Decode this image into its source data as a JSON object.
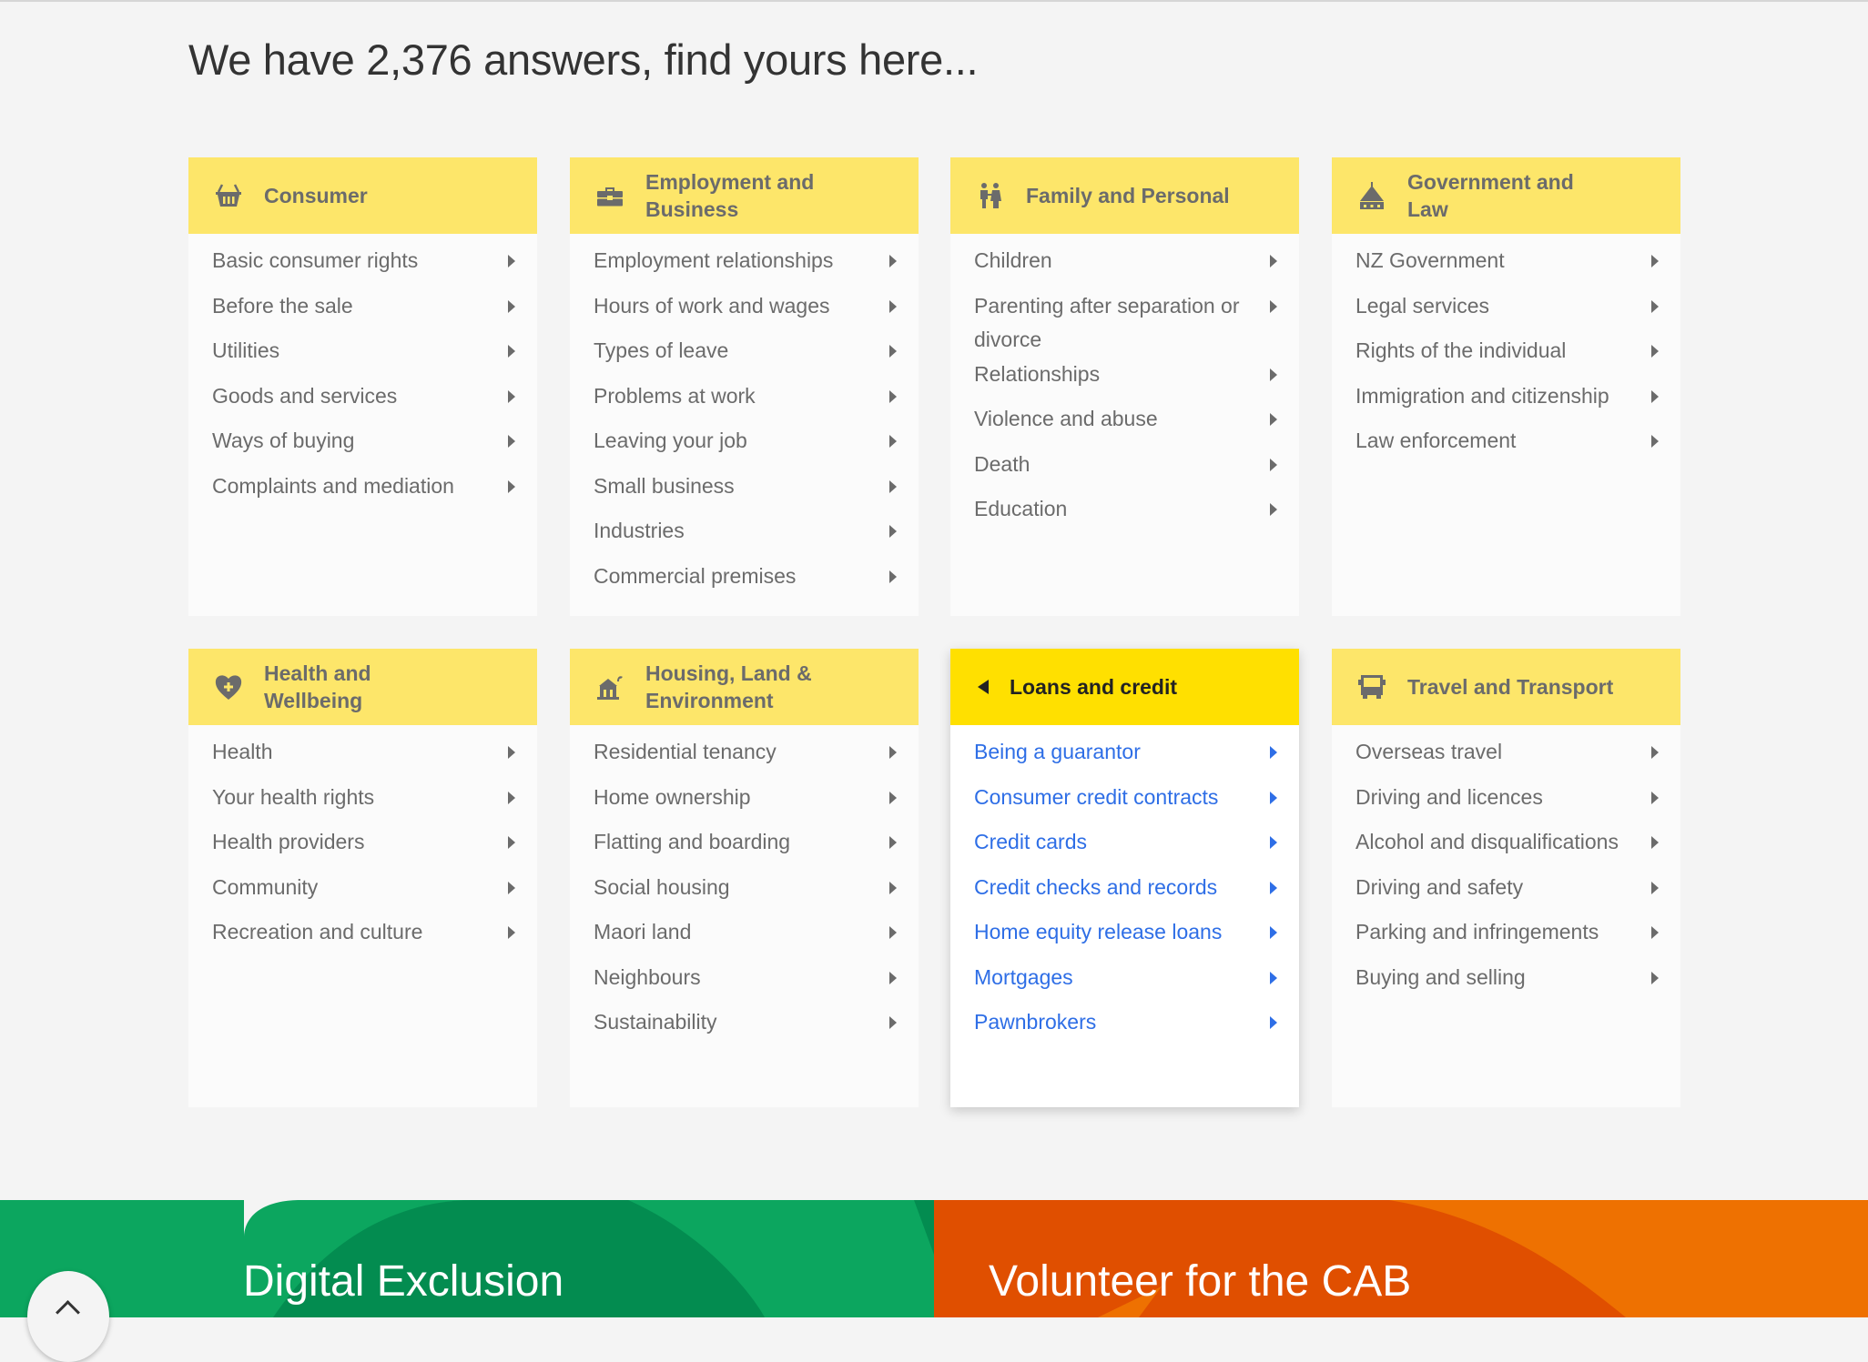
{
  "heading": "We have 2,376 answers, find yours here...",
  "colors": {
    "header_yellow": "#fde66a",
    "active_header_yellow": "#ffe000",
    "link_blue": "#2e6ee6",
    "text_grey": "#6b6b6b",
    "banner_green": "#0ca65f",
    "banner_orange": "#ee7101"
  },
  "cards": [
    {
      "title": "Consumer",
      "icon": "basket-icon",
      "items": [
        "Basic consumer rights",
        "Before the sale",
        "Utilities",
        "Goods and services",
        "Ways of buying",
        "Complaints and mediation"
      ]
    },
    {
      "title": "Employment and Business",
      "icon": "toolbox-icon",
      "items": [
        "Employment relationships",
        "Hours of work and wages",
        "Types of leave",
        "Problems at work",
        "Leaving your job",
        "Small business",
        "Industries",
        "Commercial premises"
      ]
    },
    {
      "title": "Family and Personal",
      "icon": "family-icon",
      "items": [
        "Children",
        "Parenting after separation or divorce",
        "Relationships",
        "Violence and abuse",
        "Death",
        "Education"
      ]
    },
    {
      "title": "Government and Law",
      "icon": "marae-icon",
      "items": [
        "NZ Government",
        "Legal services",
        "Rights of the individual",
        "Immigration and citizenship",
        "Law enforcement"
      ]
    },
    {
      "title": "Health and Wellbeing",
      "icon": "heart-plus-icon",
      "items": [
        "Health",
        "Your health rights",
        "Health providers",
        "Community",
        "Recreation and culture"
      ]
    },
    {
      "title": "Housing, Land & Environment",
      "icon": "house-icon",
      "items": [
        "Residential tenancy",
        "Home ownership",
        "Flatting and boarding",
        "Social housing",
        "Maori land",
        "Neighbours",
        "Sustainability"
      ]
    },
    {
      "title": "Loans and credit",
      "icon": "back-arrow-icon",
      "active": true,
      "items": [
        "Being a guarantor",
        "Consumer credit contracts",
        "Credit cards",
        "Credit checks and records",
        "Home equity release loans",
        "Mortgages",
        "Pawnbrokers"
      ]
    },
    {
      "title": "Travel and Transport",
      "icon": "bus-icon",
      "items": [
        "Overseas travel",
        "Driving and licences",
        "Alcohol and disqualifications",
        "Driving and safety",
        "Parking and infringements",
        "Buying and selling"
      ]
    }
  ],
  "banners": [
    {
      "title": "Digital Exclusion"
    },
    {
      "title": "Volunteer for the CAB"
    }
  ],
  "scroll_top": {
    "icon": "chevron-up-icon"
  }
}
